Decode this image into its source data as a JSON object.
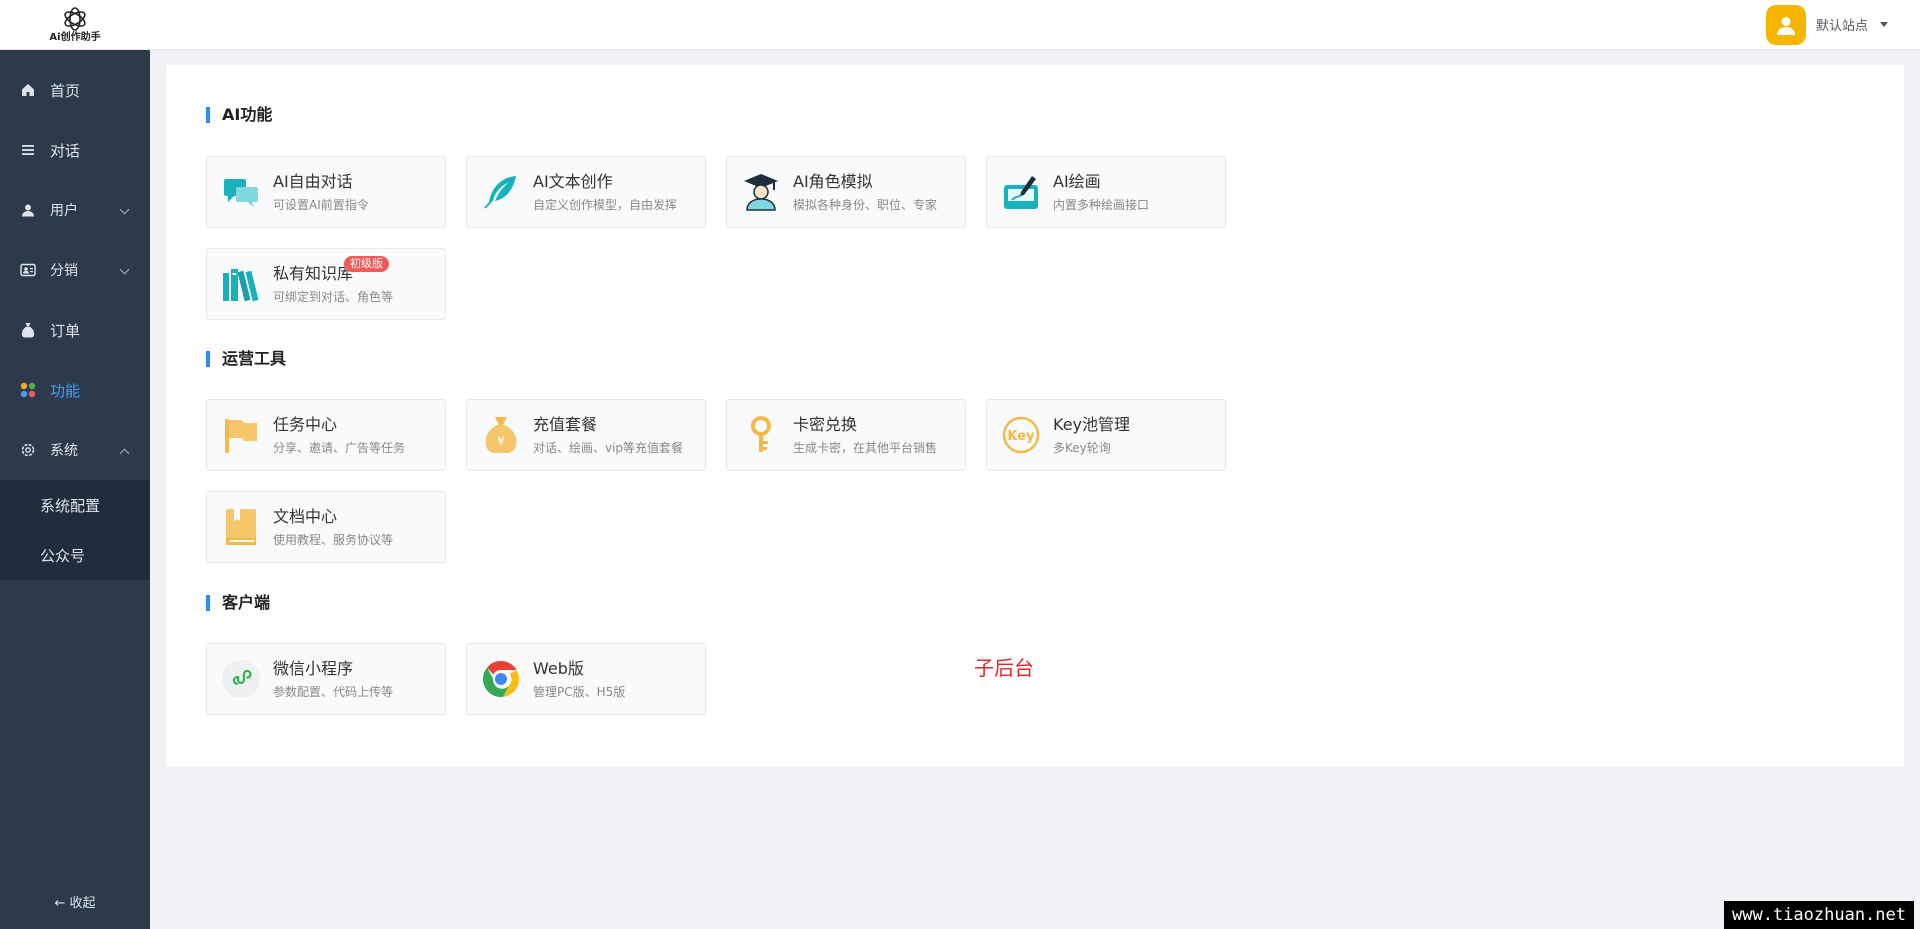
{
  "header": {
    "logo_text": "Ai创作助手",
    "site_name": "默认站点"
  },
  "sidebar": {
    "items": [
      {
        "label": "首页"
      },
      {
        "label": "对话"
      },
      {
        "label": "用户"
      },
      {
        "label": "分销"
      },
      {
        "label": "订单"
      },
      {
        "label": "功能"
      },
      {
        "label": "系统"
      }
    ],
    "submenu": [
      {
        "label": "系统配置"
      },
      {
        "label": "公众号"
      }
    ],
    "collapse_label": "收起"
  },
  "sections": [
    {
      "title": "AI功能",
      "cards": [
        {
          "title": "AI自由对话",
          "desc": "可设置AI前置指令",
          "icon": "chat-bubbles-icon"
        },
        {
          "title": "AI文本创作",
          "desc": "自定义创作模型，自由发挥",
          "icon": "feather-icon"
        },
        {
          "title": "AI角色模拟",
          "desc": "模拟各种身份、职位、专家",
          "icon": "graduate-icon"
        },
        {
          "title": "AI绘画",
          "desc": "内置多种绘画接口",
          "icon": "paint-icon"
        },
        {
          "title": "私有知识库",
          "desc": "可绑定到对话、角色等",
          "icon": "books-icon",
          "badge": "初级版"
        }
      ]
    },
    {
      "title": "运营工具",
      "cards": [
        {
          "title": "任务中心",
          "desc": "分享、邀请、广告等任务",
          "icon": "flag-icon"
        },
        {
          "title": "充值套餐",
          "desc": "对话、绘画、vip等充值套餐",
          "icon": "money-bag-icon"
        },
        {
          "title": "卡密兑换",
          "desc": "生成卡密，在其他平台销售",
          "icon": "key-icon"
        },
        {
          "title": "Key池管理",
          "desc": "多Key轮询",
          "icon": "key-circle-icon"
        },
        {
          "title": "文档中心",
          "desc": "使用教程、服务协议等",
          "icon": "book-icon"
        }
      ]
    },
    {
      "title": "客户端",
      "cards": [
        {
          "title": "微信小程序",
          "desc": "参数配置、代码上传等",
          "icon": "mini-program-icon"
        },
        {
          "title": "Web版",
          "desc": "管理PC版、H5版",
          "icon": "chrome-icon"
        }
      ]
    }
  ],
  "annotation": "子后台",
  "watermark": "www.tiaozhuan.net",
  "colors": {
    "sidebar_bg": "#2d3a4b",
    "active": "#409eff",
    "section_bar": "#2d8cf0",
    "teal": "#19b2bc",
    "amber": "#f5b94a"
  }
}
